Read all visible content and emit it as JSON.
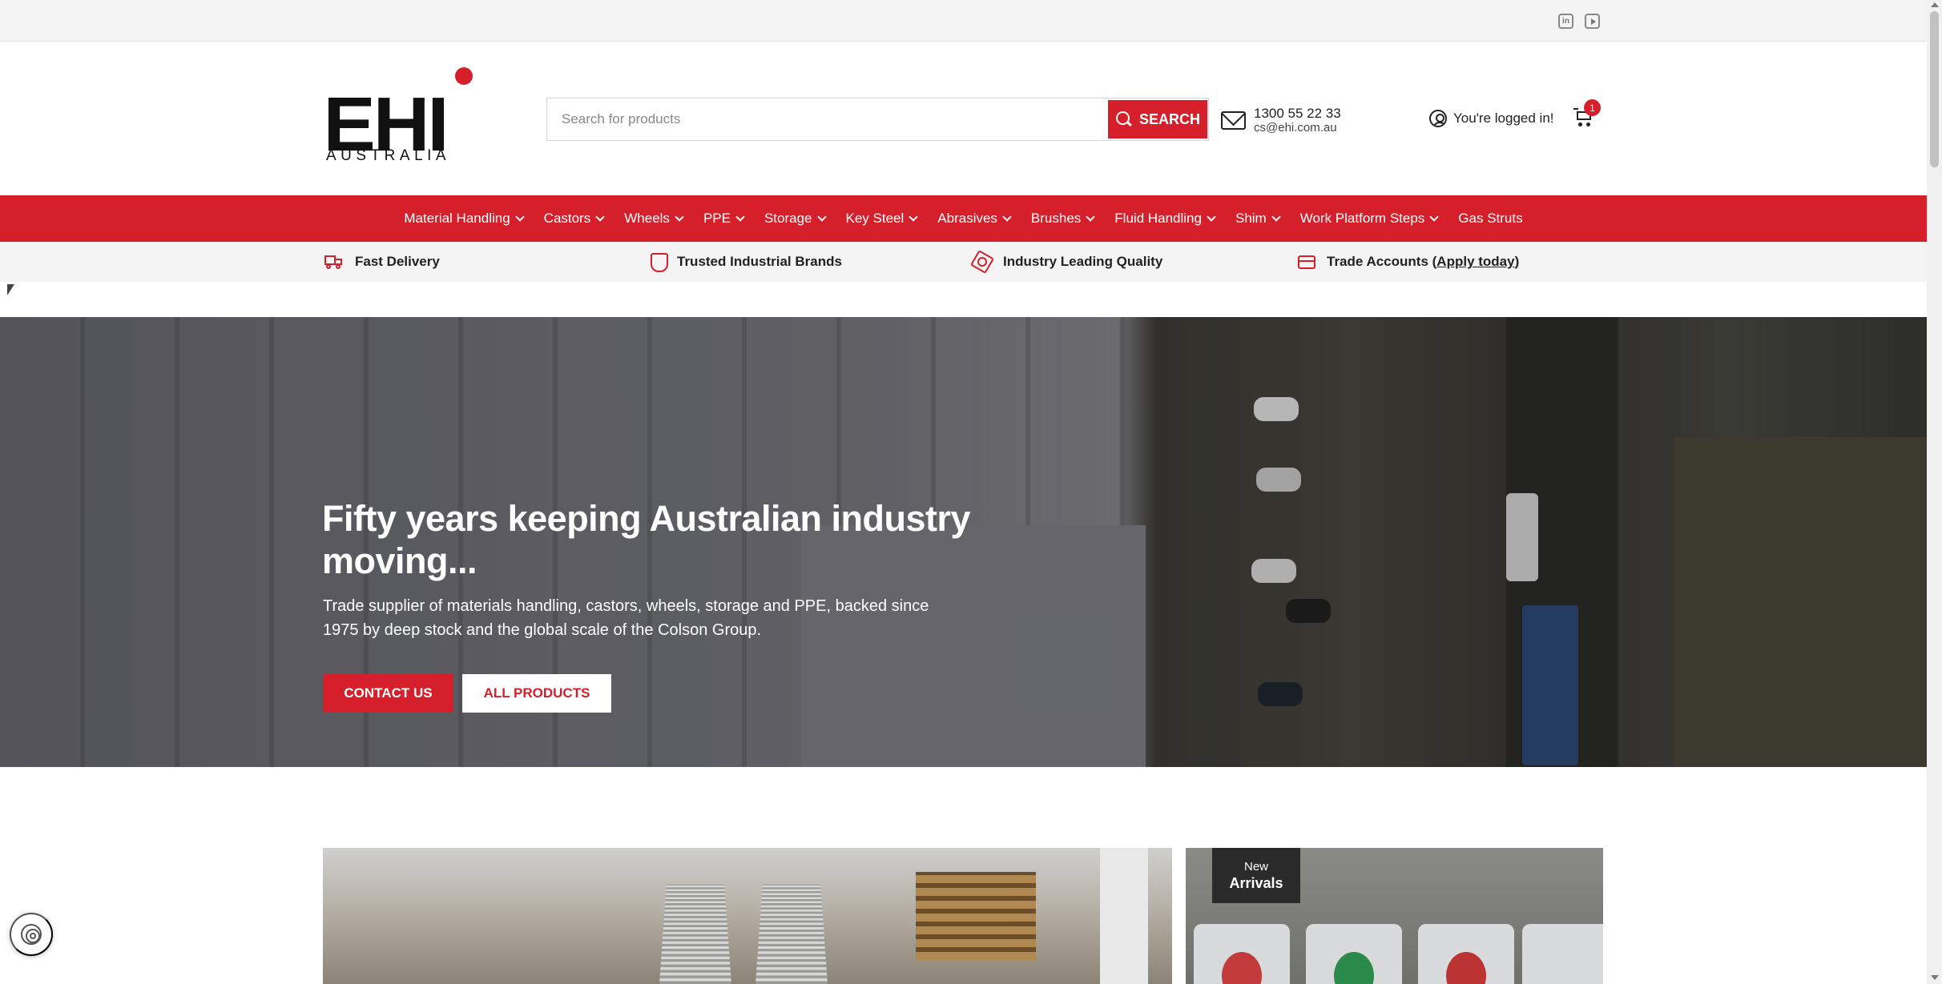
{
  "social": {
    "linkedin": "in"
  },
  "brand": {
    "logo_main": "EHI",
    "logo_sub": "AUSTRALIA"
  },
  "search": {
    "placeholder": "Search for products",
    "button_label": "SEARCH"
  },
  "contact": {
    "phone": "1300 55 22 33",
    "email": "cs@ehi.com.au"
  },
  "account": {
    "label": "You're logged in!",
    "cart_count": "1"
  },
  "nav": [
    {
      "label": "Material Handling",
      "dropdown": true
    },
    {
      "label": "Castors",
      "dropdown": true
    },
    {
      "label": "Wheels",
      "dropdown": true
    },
    {
      "label": "PPE",
      "dropdown": true
    },
    {
      "label": "Storage",
      "dropdown": true
    },
    {
      "label": "Key Steel",
      "dropdown": true
    },
    {
      "label": "Abrasives",
      "dropdown": true
    },
    {
      "label": "Brushes",
      "dropdown": true
    },
    {
      "label": "Fluid Handling",
      "dropdown": true
    },
    {
      "label": "Shim",
      "dropdown": true
    },
    {
      "label": "Work Platform Steps",
      "dropdown": true
    },
    {
      "label": "Gas Struts",
      "dropdown": false
    }
  ],
  "usp": {
    "fast_delivery": "Fast Delivery",
    "trusted_brands": "Trusted Industrial Brands",
    "quality": "Industry Leading Quality",
    "trade_prefix": "Trade Accounts (",
    "trade_link": "Apply today",
    "trade_suffix": ")"
  },
  "hero": {
    "title": "Fifty years keeping Australian industry moving...",
    "subtitle": "Trade supplier of materials handling, castors, wheels, storage and PPE, backed since 1975 by deep stock and the global scale of the Colson Group.",
    "contact_button": "CONTACT US",
    "products_button": "ALL PRODUCTS"
  },
  "tiles": {
    "new_line1": "New",
    "new_line2": "Arrivals"
  },
  "colors": {
    "brand_red": "#d51f2a",
    "nav_bg": "#d51f2a",
    "topbar_bg": "#f4f4f4"
  }
}
